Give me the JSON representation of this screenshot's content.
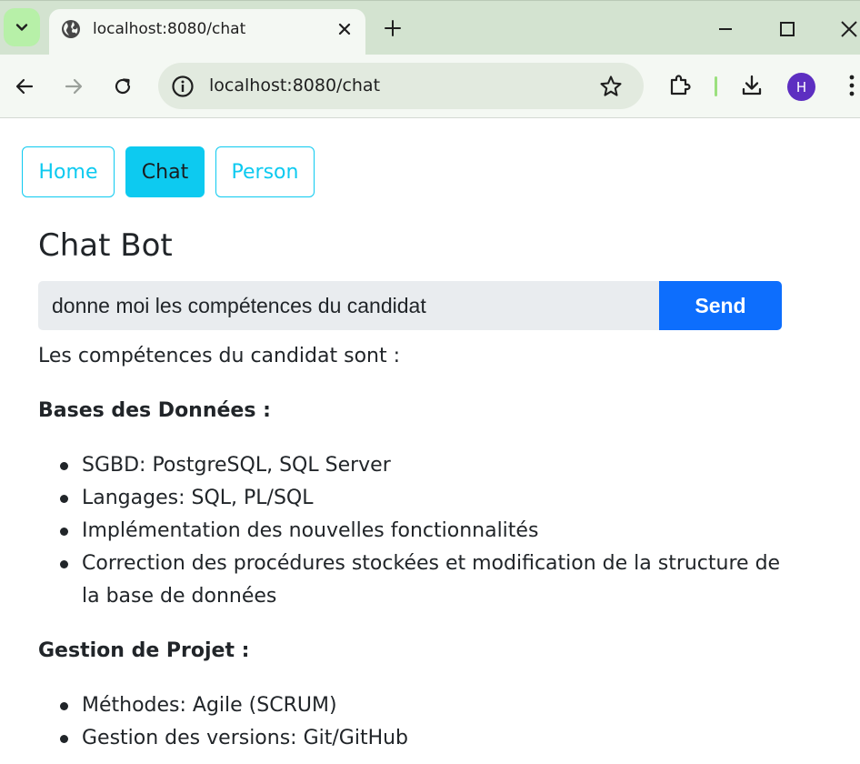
{
  "browser": {
    "tab_title": "localhost:8080/chat",
    "url": "localhost:8080/chat",
    "profile_initial": "H",
    "accent_color": "#b7f0a8",
    "profile_color": "#5d2fc1"
  },
  "nav": {
    "items": [
      {
        "label": "Home",
        "active": false
      },
      {
        "label": "Chat",
        "active": true
      },
      {
        "label": "Person",
        "active": false
      }
    ],
    "color": "#0dcaf0"
  },
  "chat": {
    "title": "Chat Bot",
    "input_value": "donne moi les compétences du candidat",
    "send_label": "Send",
    "send_color": "#0d6efd"
  },
  "answer": {
    "intro": "Les compétences du candidat sont :",
    "sections": [
      {
        "title": "Bases des Données :",
        "items": [
          "SGBD: PostgreSQL, SQL Server",
          "Langages: SQL, PL/SQL",
          "Implémentation des nouvelles fonctionnalités",
          "Correction des procédures stockées et modification de la structure de la base de données"
        ]
      },
      {
        "title": "Gestion de Projet :",
        "items": [
          "Méthodes: Agile (SCRUM)",
          "Gestion des versions: Git/GitHub"
        ]
      }
    ]
  },
  "icons": {
    "tab_search": "chevron-down-icon",
    "tab_favicon": "globe-icon",
    "tab_close": "close-icon",
    "new_tab": "plus-icon",
    "minimize": "minimize-icon",
    "maximize": "maximize-icon",
    "close_window": "close-icon",
    "back": "back-arrow-icon",
    "forward": "forward-arrow-icon",
    "reload": "reload-icon",
    "site_info": "info-icon",
    "bookmark": "star-icon",
    "extensions": "puzzle-icon",
    "downloads": "download-icon",
    "menu": "kebab-menu-icon"
  }
}
